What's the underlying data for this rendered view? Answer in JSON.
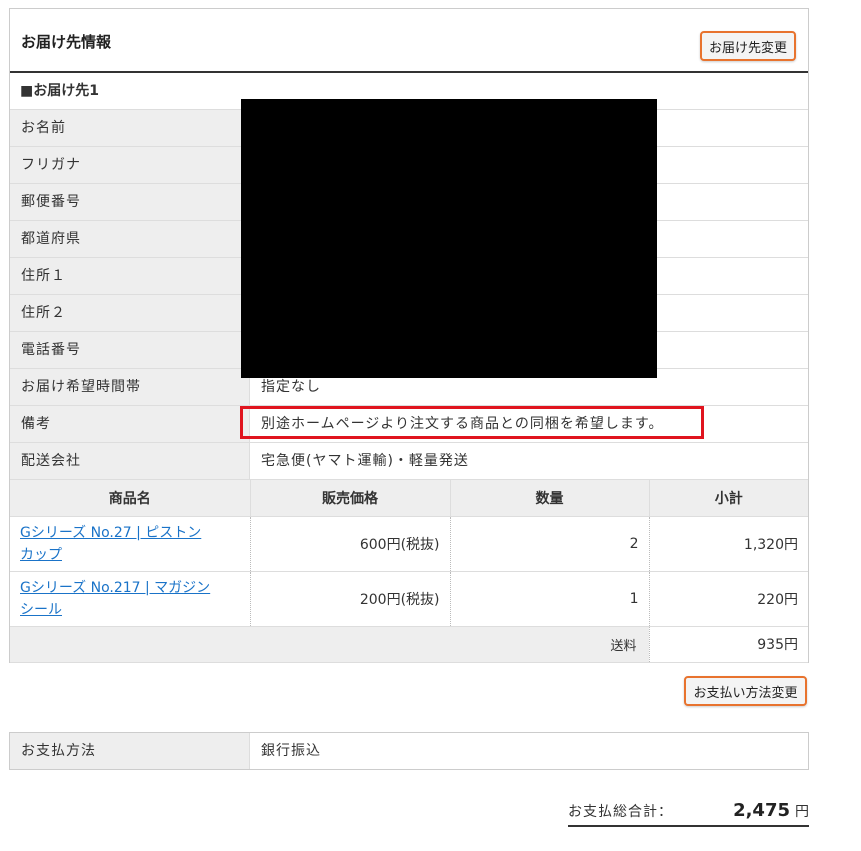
{
  "delivery": {
    "title": "お届け先情報",
    "change_button": "お届け先変更",
    "section_label": "■お届け先1",
    "rows": [
      {
        "key": "お名前",
        "value": ""
      },
      {
        "key": "フリガナ",
        "value": ""
      },
      {
        "key": "郵便番号",
        "value": ""
      },
      {
        "key": "都道府県",
        "value": ""
      },
      {
        "key": "住所１",
        "value": ""
      },
      {
        "key": "住所２",
        "value": ""
      },
      {
        "key": "電話番号",
        "value": ""
      },
      {
        "key": "お届け希望時間帯",
        "value": "指定なし"
      },
      {
        "key": "備考",
        "value": "別途ホームページより注文する商品との同梱を希望します。"
      },
      {
        "key": "配送会社",
        "value": "宅急便(ヤマト運輸)・軽量発送"
      }
    ]
  },
  "items_table": {
    "headers": [
      "商品名",
      "販売価格",
      "数量",
      "小計"
    ],
    "rows": [
      {
        "name": "Gシリーズ No.27 | ピストンカップ",
        "name_line1": "Gシリーズ No.27 | ピストン",
        "name_line2": "カップ",
        "price": "600円(税抜)",
        "qty": "2",
        "subtotal": "1,320円"
      },
      {
        "name": "Gシリーズ No.217 | マガジンシール",
        "name_line1": "Gシリーズ No.217 | マガジン",
        "name_line2": "シール",
        "price": "200円(税抜)",
        "qty": "1",
        "subtotal": "220円"
      }
    ],
    "shipping_label": "送料",
    "shipping_value": "935円"
  },
  "payment": {
    "change_button": "お支払い方法変更",
    "method_label": "お支払方法",
    "method_value": "銀行振込"
  },
  "total": {
    "label": "お支払総合計：",
    "amount": "2,475",
    "currency": "円"
  },
  "colors": {
    "accent_orange": "#e8732e",
    "highlight_red": "#e0141e",
    "link_blue": "#1a73c8"
  }
}
